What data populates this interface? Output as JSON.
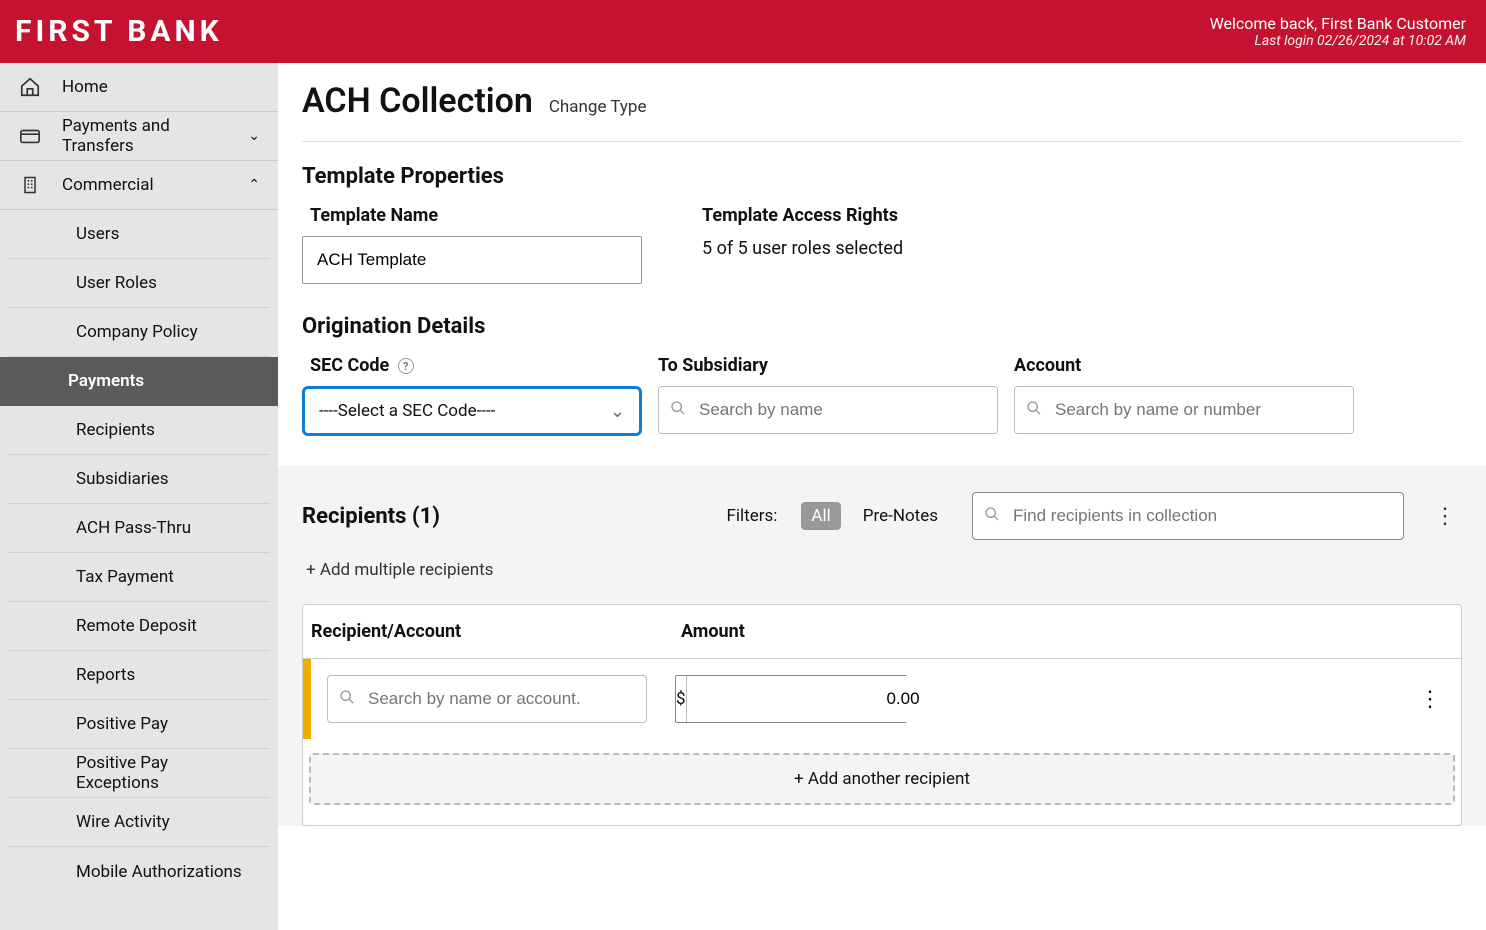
{
  "header": {
    "logo": "FIRST BANK",
    "welcome": "Welcome back, First Bank Customer",
    "last_login": "Last login 02/26/2024 at 10:02 AM"
  },
  "sidebar": {
    "top": [
      {
        "label": "Home"
      },
      {
        "label": "Payments and Transfers"
      },
      {
        "label": "Commercial"
      }
    ],
    "commercial": [
      {
        "label": "Users"
      },
      {
        "label": "User Roles"
      },
      {
        "label": "Company Policy"
      },
      {
        "label": "Payments"
      },
      {
        "label": "Recipients"
      },
      {
        "label": "Subsidiaries"
      },
      {
        "label": "ACH Pass-Thru"
      },
      {
        "label": "Tax Payment"
      },
      {
        "label": "Remote Deposit"
      },
      {
        "label": "Reports"
      },
      {
        "label": "Positive Pay"
      },
      {
        "label": "Positive Pay Exceptions"
      },
      {
        "label": "Wire Activity"
      },
      {
        "label": "Mobile Authorizations"
      }
    ]
  },
  "page": {
    "title": "ACH Collection",
    "change_type": "Change Type"
  },
  "template_props": {
    "section": "Template Properties",
    "name_label": "Template Name",
    "name_value": "ACH Template",
    "access_label": "Template Access Rights",
    "access_value": "5 of 5 user roles selected"
  },
  "origination": {
    "section": "Origination Details",
    "sec_label": "SEC Code",
    "sec_placeholder": "----Select a SEC Code----",
    "to_sub_label": "To Subsidiary",
    "to_sub_placeholder": "Search by name",
    "account_label": "Account",
    "account_placeholder": "Search by name or number"
  },
  "recipients": {
    "title": "Recipients (1)",
    "filters_label": "Filters:",
    "filter_all": "All",
    "filter_pre": "Pre-Notes",
    "search_placeholder": "Find recipients in collection",
    "add_multiple": "+ Add multiple recipients",
    "col_recipient": "Recipient/Account",
    "col_amount": "Amount",
    "row_search_placeholder": "Search by name or account.",
    "currency": "$",
    "amount_value": "0.00",
    "add_another": "+ Add another recipient"
  }
}
